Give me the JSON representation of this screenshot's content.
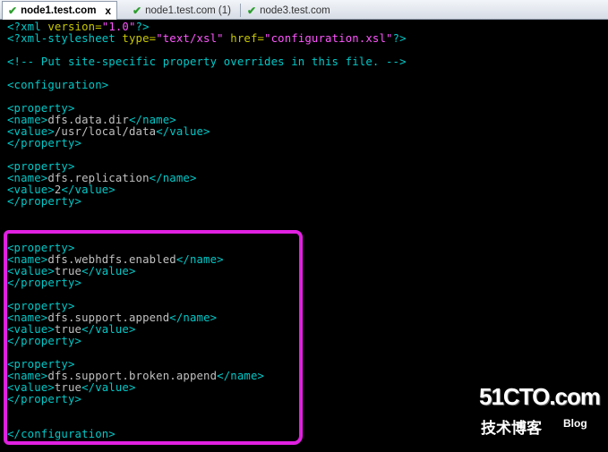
{
  "tabs": [
    {
      "label": "node1.test.com",
      "active": true,
      "close": "x"
    },
    {
      "label": "node1.test.com (1)",
      "active": false
    },
    {
      "label": "node3.test.com",
      "active": false
    }
  ],
  "colors": {
    "background": "#000000",
    "tag": "#00c8c8",
    "attr_value": "#ff55ff",
    "highlight": "#e020e0"
  },
  "editor": {
    "xml_decl": {
      "open": "<?xml",
      "attr": " version=",
      "val": "\"1.0\"",
      "close": "?>"
    },
    "stylesheet": {
      "open": "<?xml-stylesheet",
      "attr1": " type=",
      "val1": "\"text/xsl\"",
      "attr2": " href=",
      "val2": "\"configuration.xsl\"",
      "close": "?>"
    },
    "comment": "<!-- Put site-specific property overrides in this file. -->",
    "config_open": "<configuration>",
    "config_close": "</configuration>",
    "properties": [
      {
        "name": "dfs.data.dir",
        "value": "/usr/local/data"
      },
      {
        "name": "dfs.replication",
        "value": "2"
      },
      {
        "name": "dfs.webhdfs.enabled",
        "value": "true"
      },
      {
        "name": "dfs.support.append",
        "value": "true"
      },
      {
        "name": "dfs.support.broken.append",
        "value": "true"
      }
    ],
    "tags": {
      "prop_open": "<property>",
      "prop_close": "</property>",
      "name_open": "<name>",
      "name_close": "</name>",
      "value_open": "<value>",
      "value_close": "</value>"
    }
  },
  "watermark": {
    "top": "51CTO.com",
    "bottom": "技术博客",
    "blog": "Blog"
  }
}
